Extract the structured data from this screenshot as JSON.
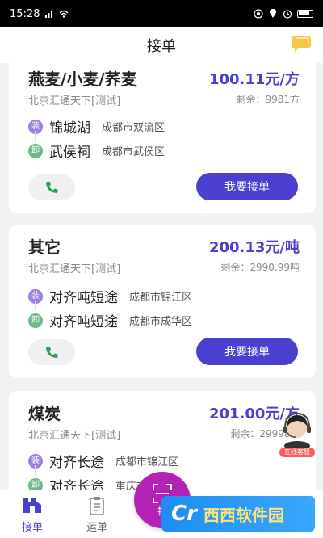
{
  "status_bar": {
    "time": "15:28"
  },
  "header": {
    "title": "接单"
  },
  "orders": [
    {
      "cargo": "燕麦/小麦/荞麦",
      "company": "北京汇通天下[测试]",
      "price": "100.11元/方",
      "remaining": "剩余：9981方",
      "load_tag": "装",
      "unload_tag": "卸",
      "load_place": "锦城湖",
      "load_area": "成都市双流区",
      "unload_place": "武侯祠",
      "unload_area": "成都市武侯区",
      "accept_label": "我要接单"
    },
    {
      "cargo": "其它",
      "company": "北京汇通天下[测试]",
      "price": "200.13元/吨",
      "remaining": "剩余：2990.99吨",
      "load_tag": "装",
      "unload_tag": "卸",
      "load_place": "对齐吨短途",
      "load_area": "成都市锦江区",
      "unload_place": "对齐吨短途",
      "unload_area": "成都市成华区",
      "accept_label": "我要接单"
    },
    {
      "cargo": "煤炭",
      "company": "北京汇通天下[测试]",
      "price": "201.00元/方",
      "remaining": "剩余：29998.1",
      "load_tag": "装",
      "unload_tag": "卸",
      "load_place": "对齐长途",
      "load_area": "成都市锦江区",
      "unload_place": "对齐长途",
      "unload_area": "重庆市",
      "accept_label": "我要接单"
    }
  ],
  "online_service": {
    "label": "在线客服"
  },
  "tabbar": {
    "tabs": [
      {
        "label": "接单",
        "icon": "truck-icon"
      },
      {
        "label": "运单",
        "icon": "clipboard-icon"
      },
      {
        "label": "扫",
        "icon": "scan-icon"
      }
    ]
  },
  "watermark": {
    "brand": "Cr",
    "site": "西西软件园"
  },
  "colors": {
    "accent": "#4a3fd0",
    "scan": "#b421b5",
    "load": "#9b7ee6",
    "unload": "#6eb98a"
  }
}
